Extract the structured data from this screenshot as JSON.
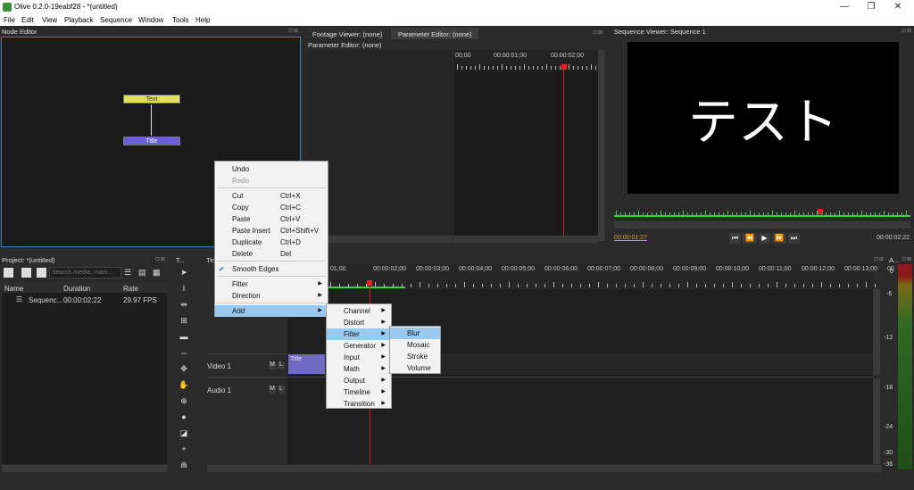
{
  "window": {
    "title": "Olive 0.2.0-19eabf28 - *(untitled)",
    "minimize": "—",
    "restore": "❐",
    "close": "✕"
  },
  "menubar": [
    "File",
    "Edit",
    "View",
    "Playback",
    "Sequence",
    "Window",
    "Tools",
    "Help"
  ],
  "node_editor": {
    "title": "Node Editor",
    "nodes": [
      {
        "label": "Text",
        "color": "#dfe05a"
      },
      {
        "label": "Title",
        "color": "#6b5fd6"
      }
    ]
  },
  "tabs": {
    "footage_viewer": "Footage Viewer: (none)",
    "param_editor_tab": "Parameter Editor: (none)"
  },
  "param_editor": {
    "title": "Parameter Editor: (none)",
    "ruler": [
      "00;00",
      "00:00:01;00",
      "00:00:02;00"
    ]
  },
  "sequence_viewer": {
    "title": "Sequence Viewer: Sequence 1",
    "preview_text": "テスト",
    "timecode_current": "00:00:01:27",
    "timecode_end": "00:00:02;22"
  },
  "project": {
    "title": "Project: *(untitled)",
    "search_placeholder": "Search media, mark...",
    "columns": [
      "Name",
      "Duration",
      "Rate"
    ],
    "rows": [
      {
        "name": "Sequenc...",
        "duration": "00:00:02;22",
        "rate": "29.97 FPS"
      }
    ]
  },
  "tools_title": "T...",
  "timeline": {
    "title": "Tim",
    "ruler": [
      "01;00",
      "00:00:02;00",
      "00:00:03;00",
      "00:00:04;00",
      "00:00:05;00",
      "00:00:06;00",
      "00:00:07;00",
      "00:00:08;00",
      "00:00:09;00",
      "00:00:10;00",
      "00:00:11;00",
      "00:00:12;00",
      "00:00:13;00",
      "00"
    ],
    "tracks": [
      {
        "name": "Video 1",
        "m": "M",
        "l": "L"
      },
      {
        "name": "Audio 1",
        "m": "M",
        "l": "L"
      }
    ],
    "clip": "Title"
  },
  "audio_meter": {
    "title": "A...",
    "labels": [
      "0",
      "-6",
      "-12",
      "-18",
      "-24",
      "-30",
      "-36"
    ]
  },
  "context_menu": {
    "items": [
      {
        "label": "Undo",
        "shortcut": ""
      },
      {
        "label": "Redo",
        "shortcut": "",
        "disabled": true
      },
      {
        "label": "Cut",
        "shortcut": "Ctrl+X"
      },
      {
        "label": "Copy",
        "shortcut": "Ctrl+C"
      },
      {
        "label": "Paste",
        "shortcut": "Ctrl+V"
      },
      {
        "label": "Paste Insert",
        "shortcut": "Ctrl+Shift+V"
      },
      {
        "label": "Duplicate",
        "shortcut": "Ctrl+D"
      },
      {
        "label": "Delete",
        "shortcut": "Del"
      },
      {
        "label": "Smooth Edges",
        "checked": true
      },
      {
        "label": "Filter",
        "submenu": true
      },
      {
        "label": "Direction",
        "submenu": true
      },
      {
        "label": "Add",
        "submenu": true,
        "highlighted": true
      }
    ]
  },
  "add_submenu": [
    "Channel",
    "Distort",
    "Filter",
    "Generator",
    "Input",
    "Math",
    "Output",
    "Timeline",
    "Transition"
  ],
  "filter_submenu": [
    "Blur",
    "Mosaic",
    "Stroke",
    "Volume"
  ]
}
